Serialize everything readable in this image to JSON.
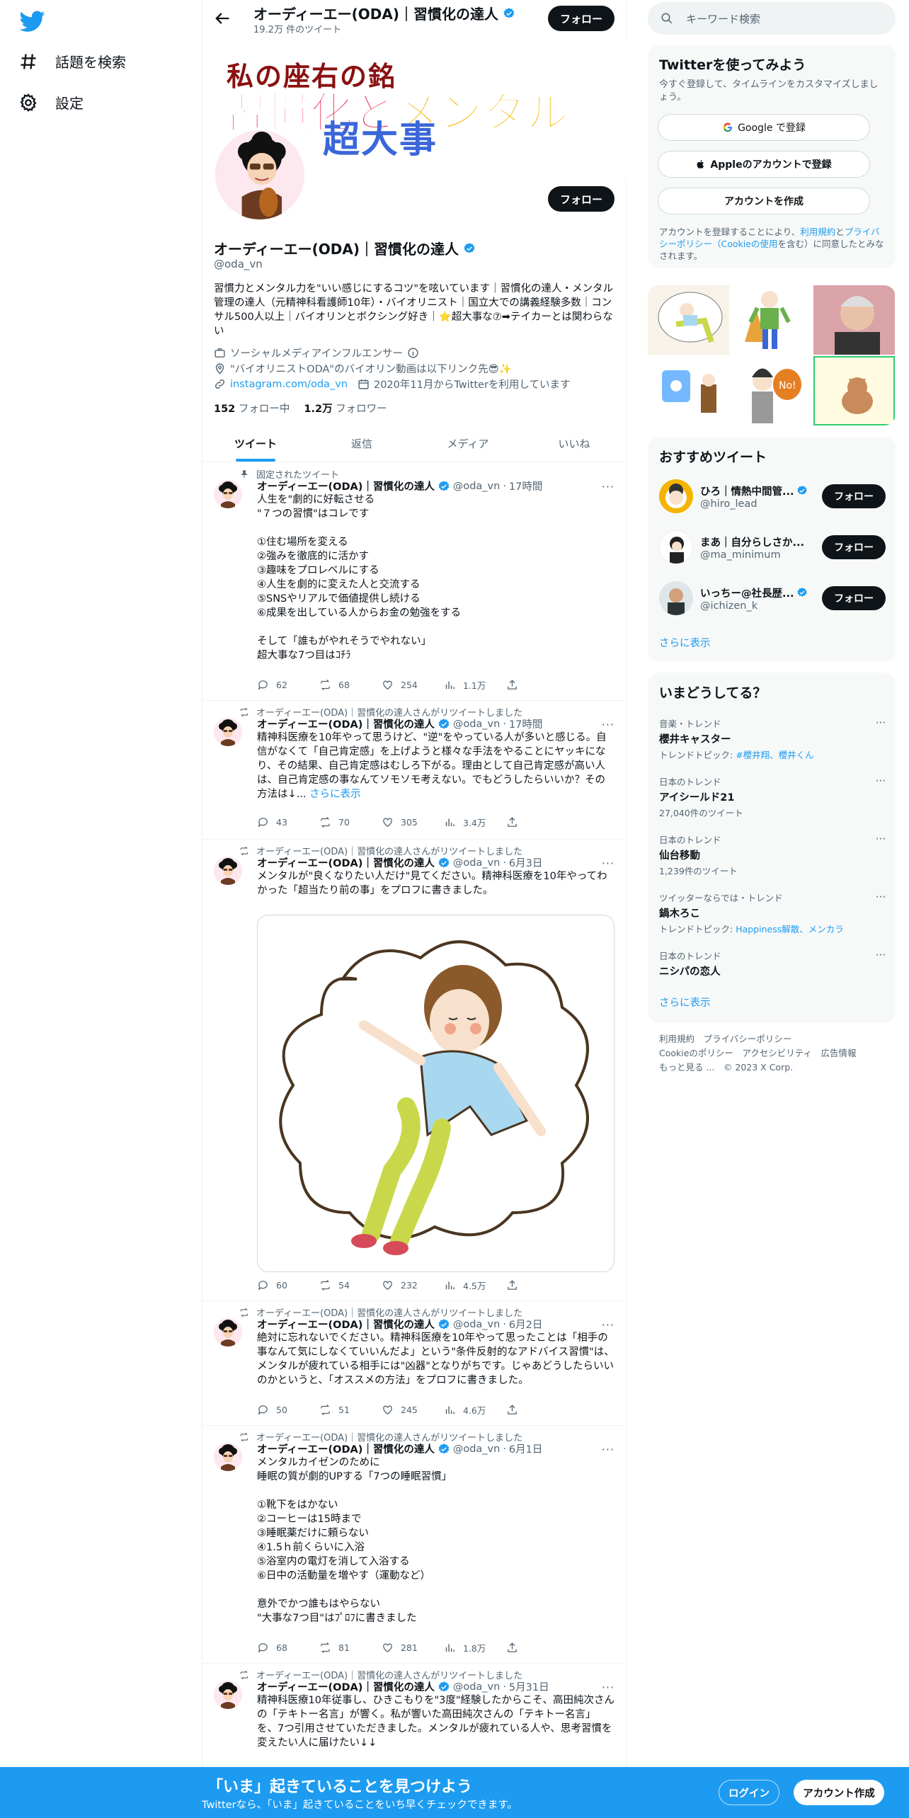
{
  "nav": {
    "explore": "話題を検索",
    "settings": "設定"
  },
  "topbar": {
    "name": "オーディーエー(ODA)｜習慣化の達人",
    "tweet_count": "19.2万 件のツイート",
    "follow": "フォロー"
  },
  "banner": {
    "line1": "私の座右の銘",
    "line2a": "習慣化と",
    "line2b": "メンタル",
    "line3": "超大事"
  },
  "profile": {
    "follow": "フォロー",
    "name": "オーディーエー(ODA)｜習慣化の達人",
    "handle": "@oda_vn",
    "bio": "習慣力とメンタル力を\"いい感じにするコツ\"を呟いています｜習慣化の達人・メンタル管理の達人（元精神科看護師10年）・バイオリニスト｜国立大での講義経験多数｜コンサル500人以上｜バイオリンとボクシング好き｜⭐超大事な⑦➡テイカーとは関わらない",
    "category": "ソーシャルメディアインフルエンサー",
    "location": "\"バイオリニストODA\"のバイオリン動画は以下リンク先😎✨",
    "url": "instagram.com/oda_vn",
    "joined": "2020年11月からTwitterを利用しています",
    "following_count": "152",
    "following_label": "フォロー中",
    "followers_count": "1.2万",
    "followers_label": "フォロワー"
  },
  "tabs": [
    "ツイート",
    "返信",
    "メディア",
    "いいね"
  ],
  "tweets": [
    {
      "context": "固定されたツイート",
      "name": "オーディーエー(ODA)｜習慣化の達人",
      "handle": "@oda_vn",
      "time": "17時間",
      "text": "人生を\"劇的に好転させる\n\"７つの習慣\"はコレです\n\n①住む場所を変える\n②強みを徹底的に活かす\n③趣味をプロレベルにする\n④人生を劇的に変えた人と交流する\n⑤SNSやリアルで価値提供し続ける\n⑥成果を出している人からお金の勉強をする\n\nそして「誰もがやれそうでやれない」\n超大事な7つ目はｺﾁﾗ",
      "replies": "62",
      "retweets": "68",
      "likes": "254",
      "views": "1.1万"
    },
    {
      "context": "オーディーエー(ODA)｜習慣化の達人さんがリツイートしました",
      "name": "オーディーエー(ODA)｜習慣化の達人",
      "handle": "@oda_vn",
      "time": "17時間",
      "text": "精神科医療を10年やって思うけど、\"逆\"をやっている人が多いと感じる。自信がなくて「自己肯定感」を上げようと様々な手法をやることにヤッキになり、その結果、自己肯定感はむしろ下がる。理由として自己肯定感が高い人は、自己肯定感の事なんてソモソモ考えない。でもどうしたらいいか？その方法は↓...",
      "show_more": "さらに表示",
      "replies": "43",
      "retweets": "70",
      "likes": "305",
      "views": "3.4万"
    },
    {
      "context": "オーディーエー(ODA)｜習慣化の達人さんがリツイートしました",
      "name": "オーディーエー(ODA)｜習慣化の達人",
      "handle": "@oda_vn",
      "time": "6月3日",
      "text": "メンタルが\"良くなりたい人だけ\"見てください。精神科医療を10年やってわかった「超当たり前の事」をプロフに書きました。",
      "replies": "60",
      "retweets": "54",
      "likes": "232",
      "views": "4.5万"
    },
    {
      "context": "オーディーエー(ODA)｜習慣化の達人さんがリツイートしました",
      "name": "オーディーエー(ODA)｜習慣化の達人",
      "handle": "@oda_vn",
      "time": "6月2日",
      "text": "絶対に忘れないでください。精神科医療を10年やって思ったことは「相手の事なんて気にしなくていいんだよ」という\"条件反射的なアドバイス習慣\"は、メンタルが疲れている相手には\"凶器\"となりがちです。じゃあどうしたらいいのかというと、「オススメの方法」をプロフに書きました。",
      "replies": "50",
      "retweets": "51",
      "likes": "245",
      "views": "4.6万"
    },
    {
      "context": "オーディーエー(ODA)｜習慣化の達人さんがリツイートしました",
      "name": "オーディーエー(ODA)｜習慣化の達人",
      "handle": "@oda_vn",
      "time": "6月1日",
      "text": "メンタルカイゼンのために\n睡眠の質が劇的UPする「7つの睡眠習慣」\n\n①靴下をはかない\n②コーヒーは15時まで\n③睡眠薬だけに頼らない\n④1.5ｈ前くらいに入浴\n⑤浴室内の電灯を消して入浴する\n⑥日中の活動量を増やす（運動など）\n\n意外でかつ誰もはやらない\n\"大事な7つ目\"はﾌﾟﾛﾌに書きました",
      "replies": "68",
      "retweets": "81",
      "likes": "281",
      "views": "1.8万"
    },
    {
      "context": "オーディーエー(ODA)｜習慣化の達人さんがリツイートしました",
      "name": "オーディーエー(ODA)｜習慣化の達人",
      "handle": "@oda_vn",
      "time": "5月31日",
      "text": "精神科医療10年従事し、ひきこもりを\"3度\"経験したからこそ、高田純次さんの「テキトー名言」が響く。私が響いた高田純次さんの「テキトー名言」を、7つ引用させていただきました。メンタルが疲れている人や、思考習慣を変えたい人に届けたい↓↓"
    }
  ],
  "right": {
    "search_placeholder": "キーワード検索",
    "signup": {
      "title": "Twitterを使ってみよう",
      "desc": "今すぐ登録して、タイムラインをカスタマイズしましょう。",
      "google": "Google で登録",
      "apple": "Appleのアカウントで登録",
      "create": "アカウントを作成",
      "terms_1": "アカウントを登録することにより、",
      "terms_link1": "利用規約",
      "terms_2": "と",
      "terms_link2": "プライバシーポリシー（Cookieの使用",
      "terms_3": "を含む）に同意したとみなされます。"
    },
    "recommend": {
      "title": "おすすめツイート",
      "users": [
        {
          "name": "ひろ｜情熱中間管...",
          "handle": "@hiro_lead"
        },
        {
          "name": "まあ｜自分らしさか...",
          "handle": "@ma_minimum"
        },
        {
          "name": "いっちー@社長歴...",
          "handle": "@ichizen_k"
        }
      ],
      "follow": "フォロー",
      "more": "さらに表示"
    },
    "trends": {
      "title": "いまどうしてる？",
      "items": [
        {
          "cat": "音楽・トレンド",
          "title": "櫻井キャスター",
          "sub_label": "トレンドトピック: ",
          "sub_link": "#櫻井翔、櫻井くん"
        },
        {
          "cat": "日本のトレンド",
          "title": "アイシールド21",
          "sub": "27,040件のツイート"
        },
        {
          "cat": "日本のトレンド",
          "title": "仙台移動",
          "sub": "1,239件のツイート"
        },
        {
          "cat": "ツイッターならでは・トレンド",
          "title": "鍋木ろこ",
          "sub_label": "トレンドトピック: ",
          "sub_link": "Happiness解散、メンカラ"
        },
        {
          "cat": "日本のトレンド",
          "title": "ニシパの恋人"
        }
      ],
      "more": "さらに表示"
    },
    "footer": {
      "l1": "利用規約　プライバシーポリシー",
      "l2": "Cookieのポリシー　アクセシビリティ　広告情報",
      "l3": "もっと見る ...　© 2023 X Corp."
    }
  },
  "bottom": {
    "title": "「いま」起きていることを見つけよう",
    "sub": "Twitterなら、「いま」起きていることをいち早くチェックできます。",
    "login": "ログイン",
    "signup": "アカウント作成"
  },
  "colors": {
    "accent": "#1d9bf0",
    "text": "#0f1419",
    "muted": "#536471"
  }
}
